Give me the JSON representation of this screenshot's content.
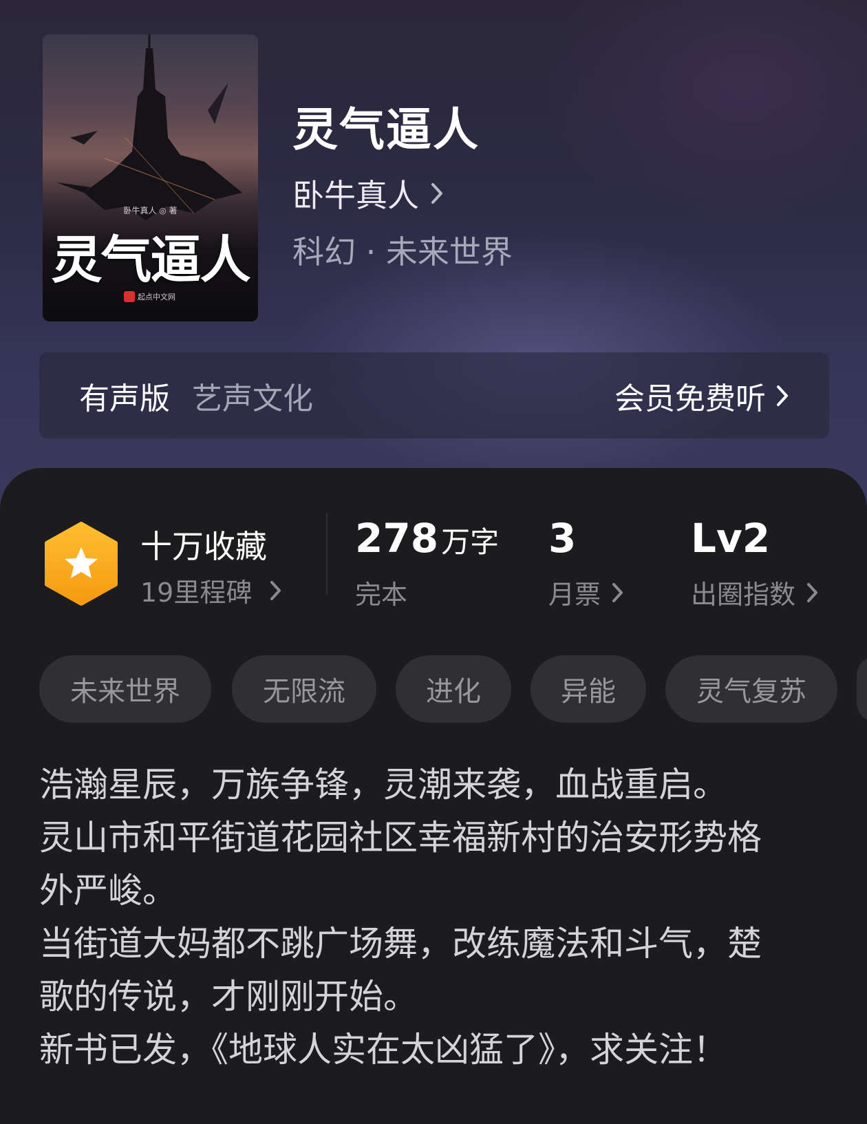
{
  "cover": {
    "author_line": "卧牛真人 ◎ 著",
    "title": "灵气逼人",
    "publisher": "起点中文网"
  },
  "book": {
    "title": "灵气逼人",
    "author": "卧牛真人",
    "genre": "科幻 · 未来世界"
  },
  "audio": {
    "label": "有声版",
    "publisher": "艺声文化",
    "action": "会员免费听"
  },
  "stats": {
    "collect_title": "十万收藏",
    "collect_sub": "19里程碑",
    "words_value": "278",
    "words_unit": "万字",
    "words_label": "完本",
    "ticket_value": "3",
    "ticket_label": "月票",
    "level_value": "Lv2",
    "level_label": "出圈指数"
  },
  "tags": [
    "未来世界",
    "无限流",
    "进化",
    "异能",
    "灵气复苏"
  ],
  "synopsis": [
    "浩瀚星辰，万族争锋，灵潮来袭，血战重启。",
    "灵山市和平街道花园社区幸福新村的治安形势格",
    "外严峻。",
    "当街道大妈都不跳广场舞，改练魔法和斗气，楚",
    "歌的传说，才刚刚开始。",
    "新书已发，《地球人实在太凶猛了》，求关注！"
  ],
  "colors": {
    "accent_orange": "#f7a21b",
    "sheet_bg": "#1c1c1e",
    "tag_bg": "#303033"
  }
}
